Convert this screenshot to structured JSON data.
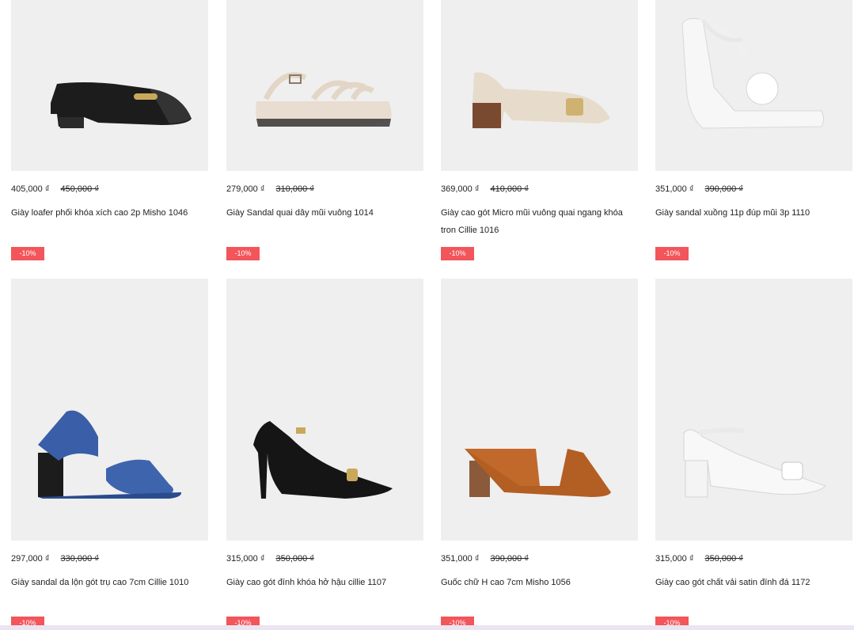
{
  "products": [
    {
      "price": "405,000 ₫",
      "old_price": "450,000 ₫",
      "name": "Giày loafer phối khóa xích cao 2p Misho 1046",
      "badge": "-10%"
    },
    {
      "price": "279,000 ₫",
      "old_price": "310,000 ₫",
      "name": "Giày Sandal quai dây mũi vuông 1014",
      "badge": "-10%"
    },
    {
      "price": "369,000 ₫",
      "old_price": "410,000 ₫",
      "name": "Giày cao gót Micro mũi vuông quai ngang khóa tron Cillie 1016",
      "badge": "-10%"
    },
    {
      "price": "351,000 ₫",
      "old_price": "390,000 ₫",
      "name": "Giày sandal xuồng 11p đúp mũi 3p 1110",
      "badge": "-10%"
    },
    {
      "price": "297,000 ₫",
      "old_price": "330,000 ₫",
      "name": "Giày sandal da lộn gót trụ cao 7cm Cillie 1010",
      "badge": "-10%"
    },
    {
      "price": "315,000 ₫",
      "old_price": "350,000 ₫",
      "name": "Giày cao gót đính khóa hở hậu cillie 1107",
      "badge": "-10%"
    },
    {
      "price": "351,000 ₫",
      "old_price": "390,000 ₫",
      "name": "Guốc chữ H cao 7cm Misho 1056",
      "badge": "-10%"
    },
    {
      "price": "315,000 ₫",
      "old_price": "350,000 ₫",
      "name": "Giày cao gót chất vải satin đính đá 1172",
      "badge": "-10%"
    }
  ],
  "colors": {
    "badge_bg": "#f2555a",
    "image_bg": "#efefef",
    "text": "#222222"
  },
  "icons": [
    "black-loafer-image",
    "beige-strappy-sandal-image",
    "cream-block-heel-pump-image",
    "white-wedge-sandal-image",
    "blue-elastic-sandal-image",
    "black-slingback-heel-image",
    "brown-h-strap-mule-image",
    "white-ankle-strap-heel-image"
  ]
}
